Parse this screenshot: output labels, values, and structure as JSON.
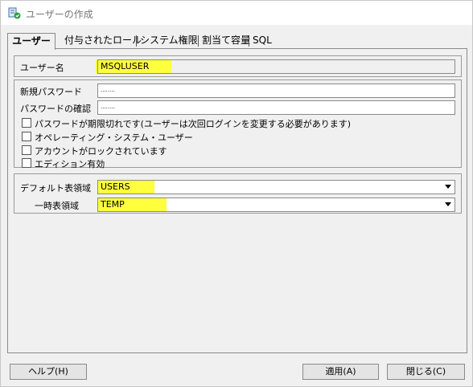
{
  "window": {
    "title": "ユーザーの作成"
  },
  "tabs": [
    {
      "label": "ユーザー",
      "active": true
    },
    {
      "label": "付与されたロール",
      "active": false
    },
    {
      "label": "システム権限",
      "active": false
    },
    {
      "label": "割当て容量",
      "active": false
    },
    {
      "label": "SQL",
      "active": false
    }
  ],
  "user": {
    "name_label": "ユーザー名",
    "name_value": "MSQLUSER"
  },
  "password": {
    "new_label": "新規パスワード",
    "new_value": "········",
    "confirm_label": "パスワードの確認",
    "confirm_value": "········"
  },
  "checks": [
    {
      "label": "パスワードが期限切れです(ユーザーは次回ログインを変更する必要があります)",
      "checked": false
    },
    {
      "label": "オペレーティング・システム・ユーザー",
      "checked": false
    },
    {
      "label": "アカウントがロックされています",
      "checked": false
    },
    {
      "label": "エディション有効",
      "checked": false
    }
  ],
  "tablespace": {
    "default_label": "デフォルト表領域",
    "default_value": "USERS",
    "temp_label": "一時表領域",
    "temp_value": "TEMP"
  },
  "buttons": {
    "help": "ヘルプ(H)",
    "apply": "適用(A)",
    "close": "閉じる(C)"
  },
  "colors": {
    "highlight": "#ffff3d",
    "background": "#f0f0f0"
  }
}
